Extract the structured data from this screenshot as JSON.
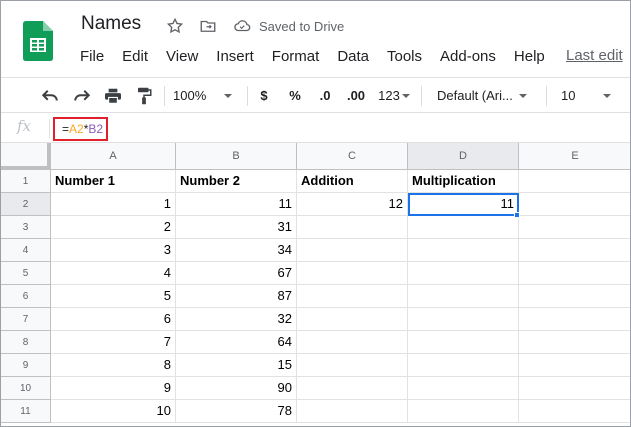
{
  "doc": {
    "title": "Names",
    "saved_status": "Saved to Drive"
  },
  "menu": [
    "File",
    "Edit",
    "View",
    "Insert",
    "Format",
    "Data",
    "Tools",
    "Add-ons",
    "Help"
  ],
  "last_edit": "Last edit",
  "toolbar": {
    "zoom": "100%",
    "currency": "$",
    "percent": "%",
    "dec_decrease": ".0",
    "dec_increase": ".00",
    "more_formats": "123",
    "font": "Default (Ari...",
    "font_size": "10"
  },
  "formula_bar": {
    "fx": "fx",
    "eq": "=",
    "ref1": "A2",
    "op": "*",
    "ref2": "B2",
    "ref1_color": "#f9a825",
    "ref2_color": "#8e5bb5"
  },
  "columns": [
    "A",
    "B",
    "C",
    "D",
    "E"
  ],
  "rows": [
    "1",
    "2",
    "3",
    "4",
    "5",
    "6",
    "7",
    "8",
    "9",
    "10",
    "11"
  ],
  "headers": {
    "a": "Number 1",
    "b": "Number 2",
    "c": "Addition",
    "d": "Multiplication"
  },
  "data": {
    "a": [
      "1",
      "2",
      "3",
      "4",
      "5",
      "6",
      "7",
      "8",
      "9",
      "10"
    ],
    "b": [
      "11",
      "31",
      "34",
      "67",
      "87",
      "32",
      "64",
      "15",
      "90",
      "78"
    ],
    "c2": "12",
    "d2": "11"
  },
  "colors": {
    "selection": "#1a73e8",
    "highlight_box": "#e0202b",
    "sheets_green": "#0f9d58"
  }
}
